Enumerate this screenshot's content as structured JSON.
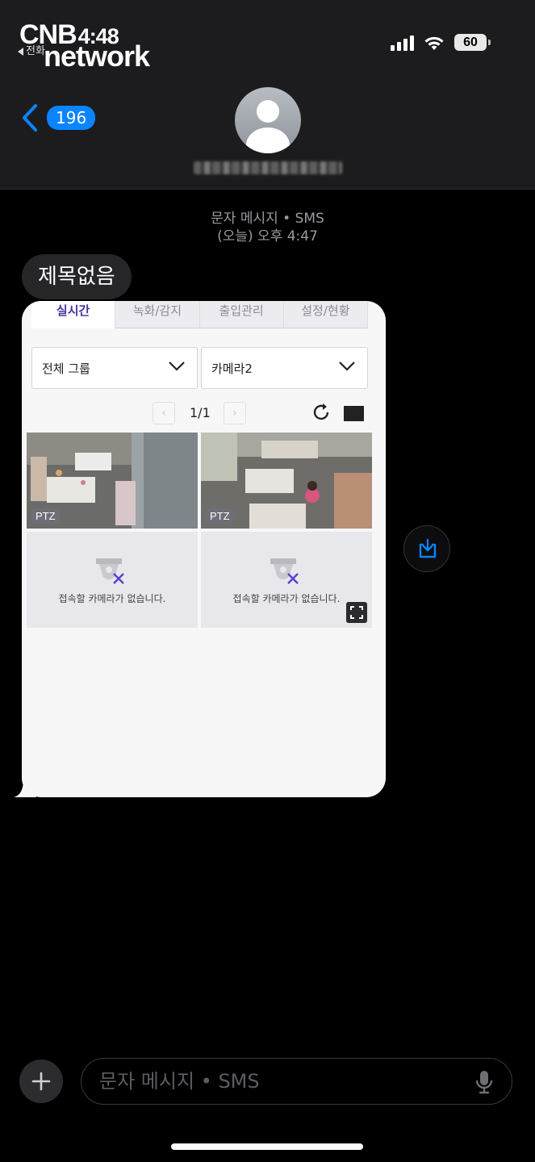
{
  "watermark": {
    "brand_top": "CNB",
    "time_overlay": "4:48",
    "brand_bottom": "network"
  },
  "status_bar": {
    "back_app": "전화",
    "battery": "60"
  },
  "header": {
    "unread_count": "196"
  },
  "thread": {
    "service_label": "문자 메시지 • SMS",
    "timestamp": "(오늘) 오후 4:47",
    "subject": "제목없음"
  },
  "attachment": {
    "tabs": [
      {
        "label": "실시간",
        "active": true
      },
      {
        "label": "녹화/감지",
        "active": false
      },
      {
        "label": "출입관리",
        "active": false
      },
      {
        "label": "설정/현황",
        "active": false
      }
    ],
    "group_select": "전체 그룹",
    "camera_select": "카메라2",
    "page_indicator": "1/1",
    "camera_tiles": [
      {
        "badge": "PTZ"
      },
      {
        "badge": "PTZ"
      }
    ],
    "empty_tiles": [
      {
        "message": "접속할 카메라가 없습니다."
      },
      {
        "message": "접속할 카메라가 없습니다."
      }
    ]
  },
  "composer": {
    "placeholder": "문자 메시지 • SMS"
  },
  "colors": {
    "accent": "#0a84ff",
    "tab_active": "#4a33a6",
    "bubble_received": "#262629"
  }
}
